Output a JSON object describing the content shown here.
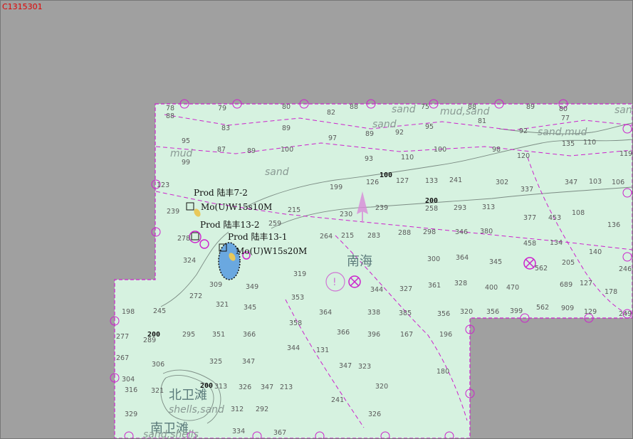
{
  "chart": {
    "id": "C1315301",
    "colors": {
      "nodata": "#a0a0a0",
      "sea": "#d6f2e0",
      "boundary": "#cc22cc",
      "depth_text": "#5a5a5a",
      "contour": "#7c8c84",
      "light_flare": "#e8c85a",
      "restricted_area": "#6aa8e0"
    }
  },
  "labels": {
    "sea_name": "南海",
    "bank_north": "北卫滩",
    "bank_south": "南卫滩",
    "contour_100": "100",
    "contour_200_east": "200",
    "contour_200_west": "200",
    "contour_200_bank": "200"
  },
  "seabed": [
    {
      "id": "sand-1",
      "text": "sand"
    },
    {
      "id": "mud-sand",
      "text": "mud,sand"
    },
    {
      "id": "sand-far-east",
      "text": "sand"
    },
    {
      "id": "sand-2",
      "text": "sand"
    },
    {
      "id": "sand-mud",
      "text": "sand,mud"
    },
    {
      "id": "mud-1",
      "text": "mud"
    },
    {
      "id": "sand-3",
      "text": "sand"
    },
    {
      "id": "shells-sand",
      "text": "shells,sand"
    },
    {
      "id": "sand-shells",
      "text": "sand,shells"
    }
  ],
  "platforms": [
    {
      "name": "Prod 陆丰7-2",
      "light": "Mo(U)W15s10M"
    },
    {
      "name": "Prod 陆丰13-2",
      "light": ""
    },
    {
      "name": "Prod 陆丰13-1",
      "light": "Mo(U)W15s20M"
    }
  ],
  "soundings": [
    "78",
    "79",
    "80",
    "82",
    "88",
    "75",
    "88",
    "89",
    "80",
    "88",
    "83",
    "89",
    "81",
    "77",
    "89",
    "92",
    "95",
    "92",
    "95",
    "87",
    "89",
    "100",
    "97",
    "93",
    "110",
    "98",
    "135",
    "99",
    "100",
    "110",
    "120",
    "119",
    "126",
    "127",
    "133",
    "241",
    "302",
    "337",
    "347",
    "103",
    "106",
    "123",
    "199",
    "215",
    "230",
    "239",
    "258",
    "293",
    "313",
    "377",
    "453",
    "108",
    "136",
    "239",
    "259",
    "264",
    "215",
    "283",
    "288",
    "298",
    "346",
    "380",
    "458",
    "134",
    "140",
    "278",
    "324",
    "319",
    "300",
    "364",
    "345",
    "562",
    "205",
    "246",
    "309",
    "349",
    "353",
    "344",
    "327",
    "361",
    "328",
    "400",
    "470",
    "689",
    "127",
    "178",
    "198",
    "245",
    "272",
    "321",
    "345",
    "358",
    "364",
    "338",
    "385",
    "356",
    "320",
    "356",
    "399",
    "562",
    "909",
    "129",
    "249",
    "277",
    "295",
    "351",
    "366",
    "366",
    "396",
    "167",
    "196",
    "289",
    "325",
    "344",
    "131",
    "267",
    "306",
    "347",
    "347",
    "323",
    "180",
    "304",
    "313",
    "326",
    "347",
    "213",
    "320",
    "316",
    "321",
    "312",
    "292",
    "241",
    "326",
    "329",
    "334",
    "367"
  ]
}
